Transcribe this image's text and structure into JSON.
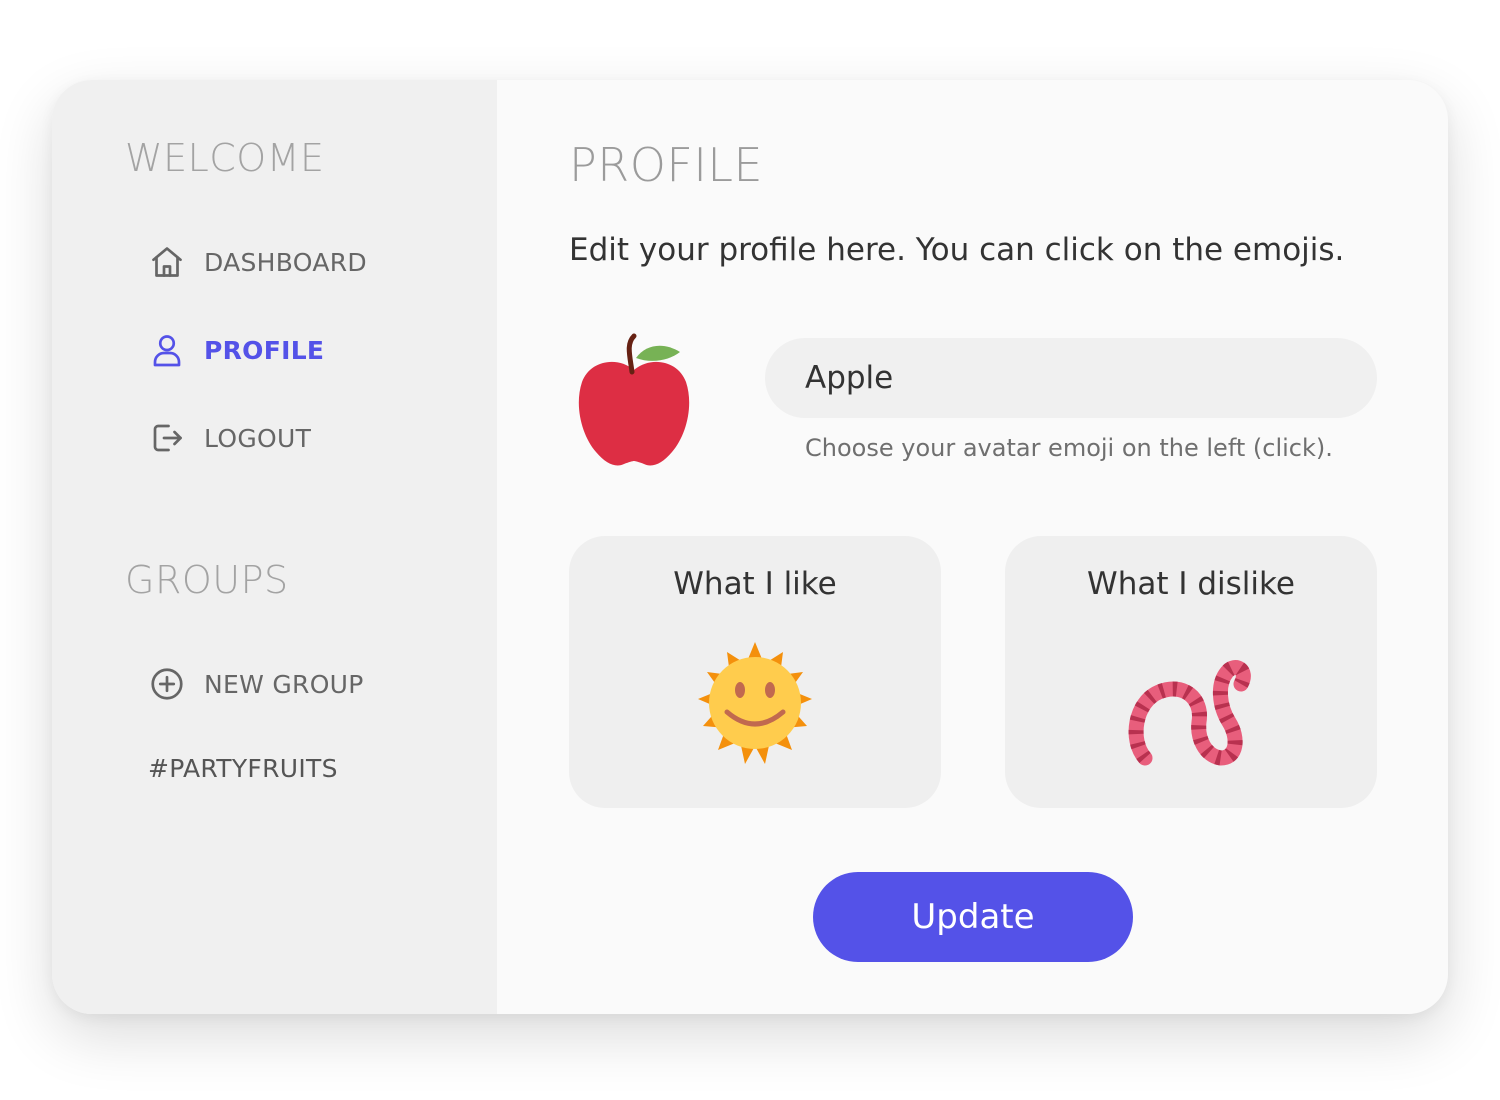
{
  "sidebar": {
    "welcome_title": "WELCOME",
    "nav": [
      {
        "label": "DASHBOARD",
        "icon": "home-icon"
      },
      {
        "label": "PROFILE",
        "icon": "user-icon",
        "active": true
      },
      {
        "label": "LOGOUT",
        "icon": "logout-icon"
      }
    ],
    "groups_title": "GROUPS",
    "new_group": {
      "label": "NEW GROUP",
      "icon": "plus-circle-icon"
    },
    "groups": [
      "#PARTYFRUITS"
    ]
  },
  "main": {
    "title": "PROFILE",
    "instruction": "Edit your profile here. You can click on the emojis.",
    "avatar": {
      "emoji": "apple-emoji"
    },
    "name_input": {
      "value": "Apple",
      "placeholder": ""
    },
    "hint": "Choose your avatar emoji on the left (click).",
    "like": {
      "label": "What I like",
      "emoji": "sun-emoji"
    },
    "dislike": {
      "label": "What I dislike",
      "emoji": "worm-emoji"
    },
    "update_label": "Update"
  },
  "colors": {
    "accent": "#5452e8",
    "sidebar_bg": "#f0f0f0",
    "main_bg": "#fafafa",
    "text_muted": "#a3a3a3"
  }
}
